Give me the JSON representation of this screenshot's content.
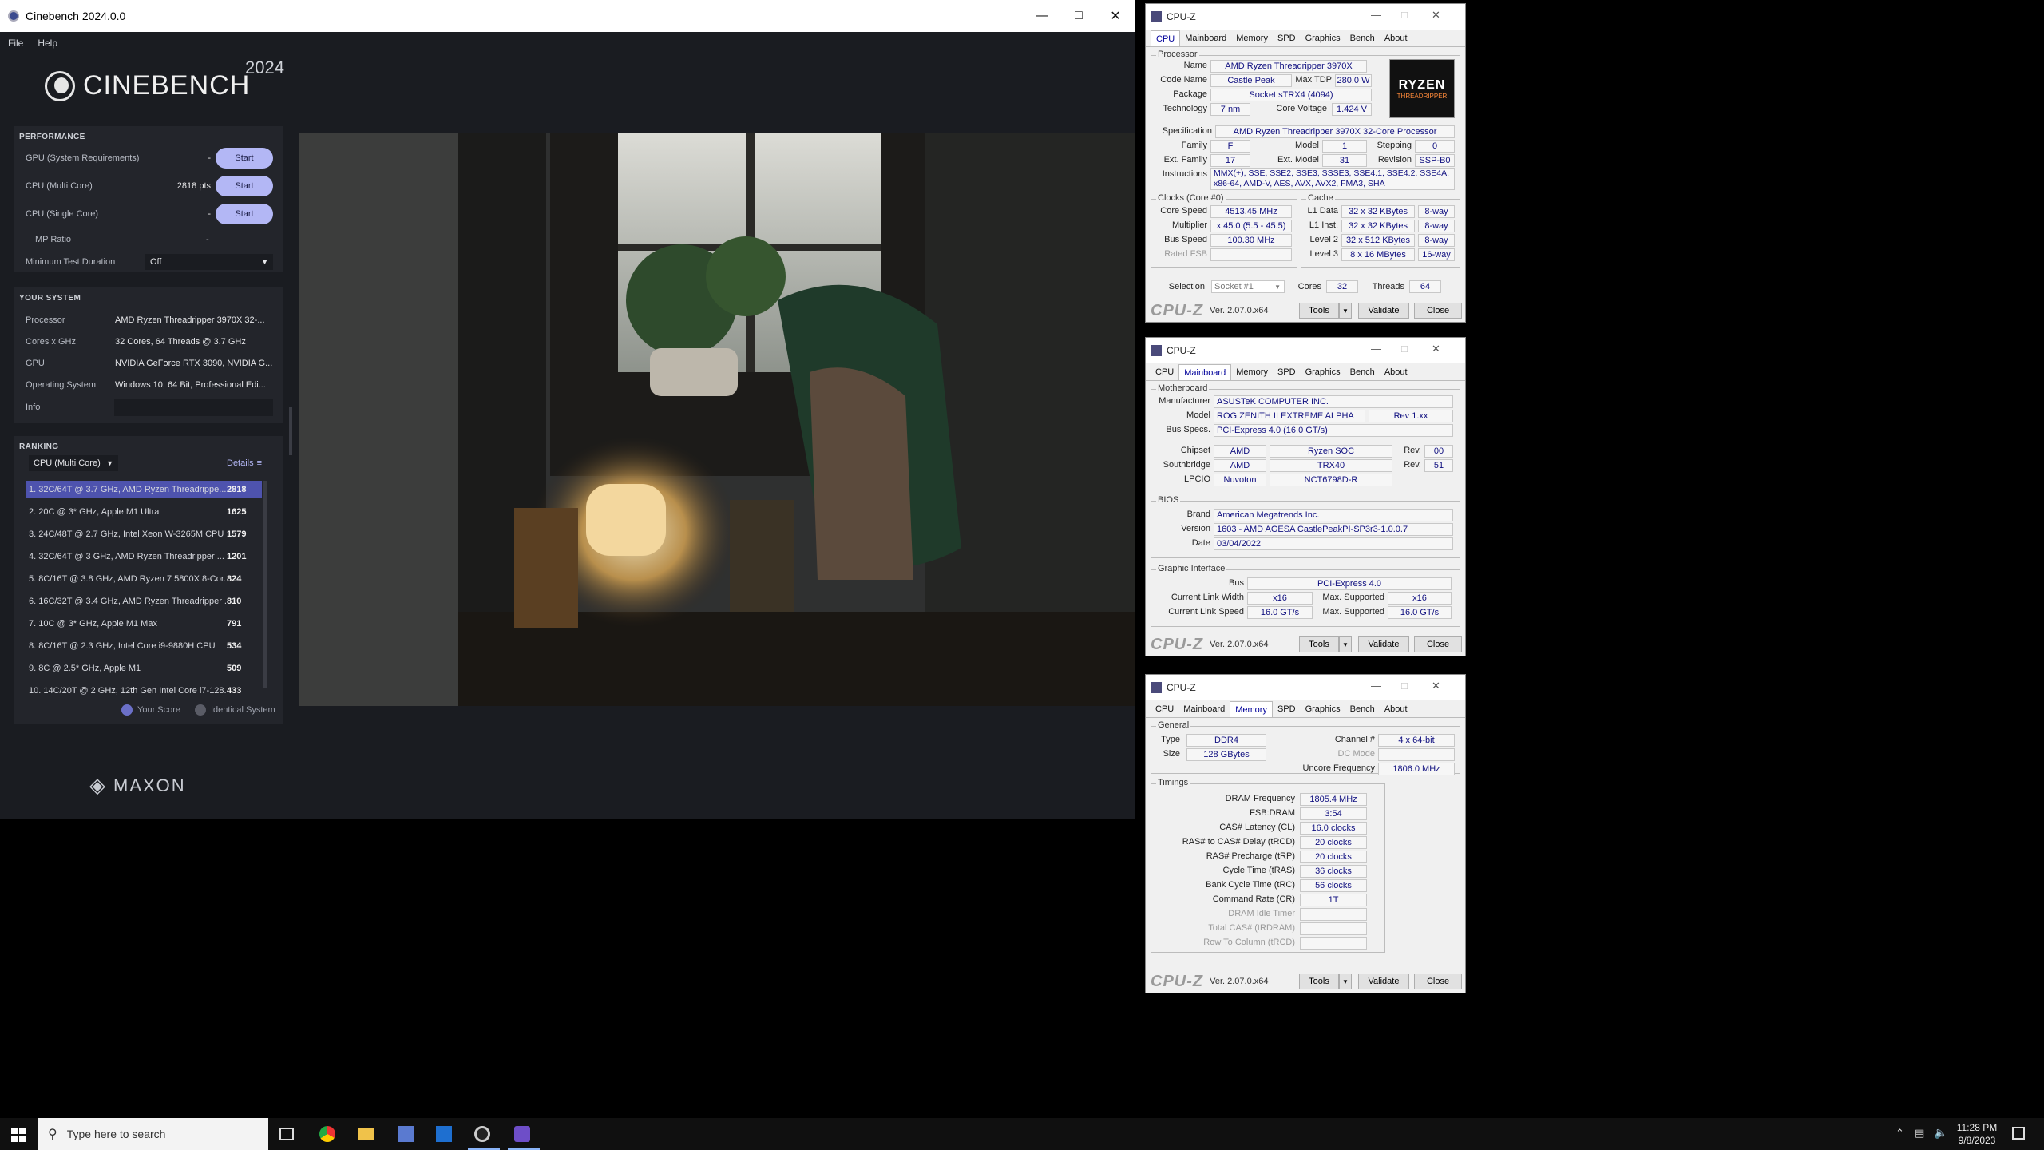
{
  "cinebench": {
    "title": "Cinebench 2024.0.0",
    "menu": [
      "File",
      "Help"
    ],
    "logo_text": "CINEBENCH",
    "logo_year": "2024",
    "performance": {
      "header": "PERFORMANCE",
      "rows": [
        {
          "label": "GPU (System Requirements)",
          "value": "-",
          "button": "Start"
        },
        {
          "label": "CPU (Multi Core)",
          "value": "2818 pts",
          "button": "Start"
        },
        {
          "label": "CPU (Single Core)",
          "value": "-",
          "button": "Start"
        }
      ],
      "mp_ratio_label": "MP Ratio",
      "mp_ratio_value": "-",
      "min_test_label": "Minimum Test Duration",
      "min_test_value": "Off"
    },
    "your_system": {
      "header": "YOUR SYSTEM",
      "rows": [
        {
          "k": "Processor",
          "v": "AMD Ryzen Threadripper 3970X 32-..."
        },
        {
          "k": "Cores x GHz",
          "v": "32 Cores, 64 Threads @ 3.7 GHz"
        },
        {
          "k": "GPU",
          "v": "NVIDIA GeForce RTX 3090, NVIDIA G..."
        },
        {
          "k": "Operating System",
          "v": "Windows 10, 64 Bit, Professional Edi..."
        },
        {
          "k": "Info",
          "v": ""
        }
      ]
    },
    "ranking": {
      "header": "RANKING",
      "dropdown": "CPU (Multi Core)",
      "details": "Details",
      "rows": [
        {
          "t": "1. 32C/64T @ 3.7 GHz, AMD Ryzen Threadrippe...",
          "s": "2818"
        },
        {
          "t": "2. 20C @ 3* GHz, Apple M1 Ultra",
          "s": "1625"
        },
        {
          "t": "3. 24C/48T @ 2.7 GHz, Intel Xeon W-3265M CPU",
          "s": "1579"
        },
        {
          "t": "4. 32C/64T @ 3 GHz, AMD Ryzen Threadripper ...",
          "s": "1201"
        },
        {
          "t": "5. 8C/16T @ 3.8 GHz, AMD Ryzen 7 5800X 8-Cor...",
          "s": "824"
        },
        {
          "t": "6. 16C/32T @ 3.4 GHz, AMD Ryzen Threadripper ...",
          "s": "810"
        },
        {
          "t": "7. 10C @ 3* GHz, Apple M1 Max",
          "s": "791"
        },
        {
          "t": "8. 8C/16T @ 2.3 GHz, Intel Core i9-9880H CPU",
          "s": "534"
        },
        {
          "t": "9. 8C @ 2.5* GHz, Apple M1",
          "s": "509"
        },
        {
          "t": "10. 14C/20T @ 2 GHz, 12th Gen Intel Core i7-128...",
          "s": "433"
        }
      ],
      "legend_your": "Your Score",
      "legend_identical": "Identical System"
    },
    "maxon": "MAXON"
  },
  "cpuz_cpu": {
    "title": "CPU-Z",
    "tabs": [
      "CPU",
      "Mainboard",
      "Memory",
      "SPD",
      "Graphics",
      "Bench",
      "About"
    ],
    "processor_label": "Processor",
    "name": "AMD Ryzen Threadripper 3970X",
    "code_name": "Castle Peak",
    "max_tdp": "280.0 W",
    "package": "Socket sTRX4 (4094)",
    "technology": "7 nm",
    "core_voltage": "1.424 V",
    "specification": "AMD Ryzen Threadripper 3970X 32-Core Processor",
    "family": "F",
    "model": "1",
    "stepping": "0",
    "ext_family": "17",
    "ext_model": "31",
    "revision": "SSP-B0",
    "instructions": "MMX(+), SSE, SSE2, SSE3, SSSE3, SSE4.1, SSE4.2, SSE4A, x86-64, AMD-V, AES, AVX, AVX2, FMA3, SHA",
    "clocks_label": "Clocks (Core #0)",
    "core_speed": "4513.45 MHz",
    "multiplier": "x 45.0 (5.5 - 45.5)",
    "bus_speed": "100.30 MHz",
    "rated_fsb": "",
    "cache_label": "Cache",
    "l1d": "32 x 32 KBytes",
    "l1d_way": "8-way",
    "l1i": "32 x 32 KBytes",
    "l1i_way": "8-way",
    "l2": "32 x 512 KBytes",
    "l2_way": "8-way",
    "l3": "8 x 16 MBytes",
    "l3_way": "16-way",
    "selection": "Socket #1",
    "cores": "32",
    "threads": "64",
    "logo_text": "RYZEN",
    "logo_sub": "THREADRIPPER",
    "labels": {
      "name": "Name",
      "code_name": "Code Name",
      "max_tdp": "Max TDP",
      "package": "Package",
      "technology": "Technology",
      "core_voltage": "Core Voltage",
      "specification": "Specification",
      "family": "Family",
      "model": "Model",
      "stepping": "Stepping",
      "ext_family": "Ext. Family",
      "ext_model": "Ext. Model",
      "revision": "Revision",
      "instructions": "Instructions",
      "core_speed": "Core Speed",
      "multiplier": "Multiplier",
      "bus_speed": "Bus Speed",
      "rated_fsb": "Rated FSB",
      "l1d": "L1 Data",
      "l1i": "L1 Inst.",
      "l2": "Level 2",
      "l3": "Level 3",
      "selection": "Selection",
      "cores": "Cores",
      "threads": "Threads"
    }
  },
  "cpuz_common": {
    "brand": "CPU-Z",
    "version": "Ver. 2.07.0.x64",
    "tools": "Tools",
    "validate": "Validate",
    "close": "Close"
  },
  "cpuz_mb": {
    "title": "CPU-Z",
    "tabs": [
      "CPU",
      "Mainboard",
      "Memory",
      "SPD",
      "Graphics",
      "Bench",
      "About"
    ],
    "mb_label": "Motherboard",
    "manufacturer": "ASUSTeK COMPUTER INC.",
    "model": "ROG ZENITH II EXTREME ALPHA",
    "model_rev": "Rev 1.xx",
    "bus_specs": "PCI-Express 4.0 (16.0 GT/s)",
    "chipset_vendor": "AMD",
    "chipset_name": "Ryzen SOC",
    "chipset_rev": "00",
    "south_vendor": "AMD",
    "south_name": "TRX40",
    "south_rev": "51",
    "lpcio_vendor": "Nuvoton",
    "lpcio_name": "NCT6798D-R",
    "bios_label": "BIOS",
    "bios_brand": "American Megatrends Inc.",
    "bios_version": "1603 - AMD AGESA CastlePeakPI-SP3r3-1.0.0.7",
    "bios_date": "03/04/2022",
    "gi_label": "Graphic Interface",
    "gi_bus": "PCI-Express 4.0",
    "link_width": "x16",
    "max_width": "x16",
    "link_speed": "16.0 GT/s",
    "max_speed": "16.0 GT/s",
    "labels": {
      "manufacturer": "Manufacturer",
      "model": "Model",
      "bus_specs": "Bus Specs.",
      "chipset": "Chipset",
      "southbridge": "Southbridge",
      "lpcio": "LPCIO",
      "rev": "Rev.",
      "brand": "Brand",
      "version": "Version",
      "date": "Date",
      "bus": "Bus",
      "link_width": "Current Link Width",
      "max_supported": "Max. Supported",
      "link_speed": "Current Link Speed"
    }
  },
  "cpuz_mem": {
    "title": "CPU-Z",
    "tabs": [
      "CPU",
      "Mainboard",
      "Memory",
      "SPD",
      "Graphics",
      "Bench",
      "About"
    ],
    "general_label": "General",
    "type": "DDR4",
    "size": "128 GBytes",
    "channel": "4 x 64-bit",
    "dc_mode": "",
    "uncore": "1806.0 MHz",
    "timings_label": "Timings",
    "timings": [
      {
        "k": "DRAM Frequency",
        "v": "1805.4 MHz",
        "gray": false
      },
      {
        "k": "FSB:DRAM",
        "v": "3:54",
        "gray": false
      },
      {
        "k": "CAS# Latency (CL)",
        "v": "16.0 clocks",
        "gray": false
      },
      {
        "k": "RAS# to CAS# Delay (tRCD)",
        "v": "20 clocks",
        "gray": false
      },
      {
        "k": "RAS# Precharge (tRP)",
        "v": "20 clocks",
        "gray": false
      },
      {
        "k": "Cycle Time (tRAS)",
        "v": "36 clocks",
        "gray": false
      },
      {
        "k": "Bank Cycle Time (tRC)",
        "v": "56 clocks",
        "gray": false
      },
      {
        "k": "Command Rate (CR)",
        "v": "1T",
        "gray": false
      },
      {
        "k": "DRAM Idle Timer",
        "v": "",
        "gray": true
      },
      {
        "k": "Total CAS# (tRDRAM)",
        "v": "",
        "gray": true
      },
      {
        "k": "Row To Column (tRCD)",
        "v": "",
        "gray": true
      }
    ],
    "labels": {
      "type": "Type",
      "size": "Size",
      "channel": "Channel #",
      "dc_mode": "DC Mode",
      "uncore": "Uncore Frequency"
    }
  },
  "taskbar": {
    "search_placeholder": "Type here to search",
    "time": "11:28 PM",
    "date": "9/8/2023"
  }
}
